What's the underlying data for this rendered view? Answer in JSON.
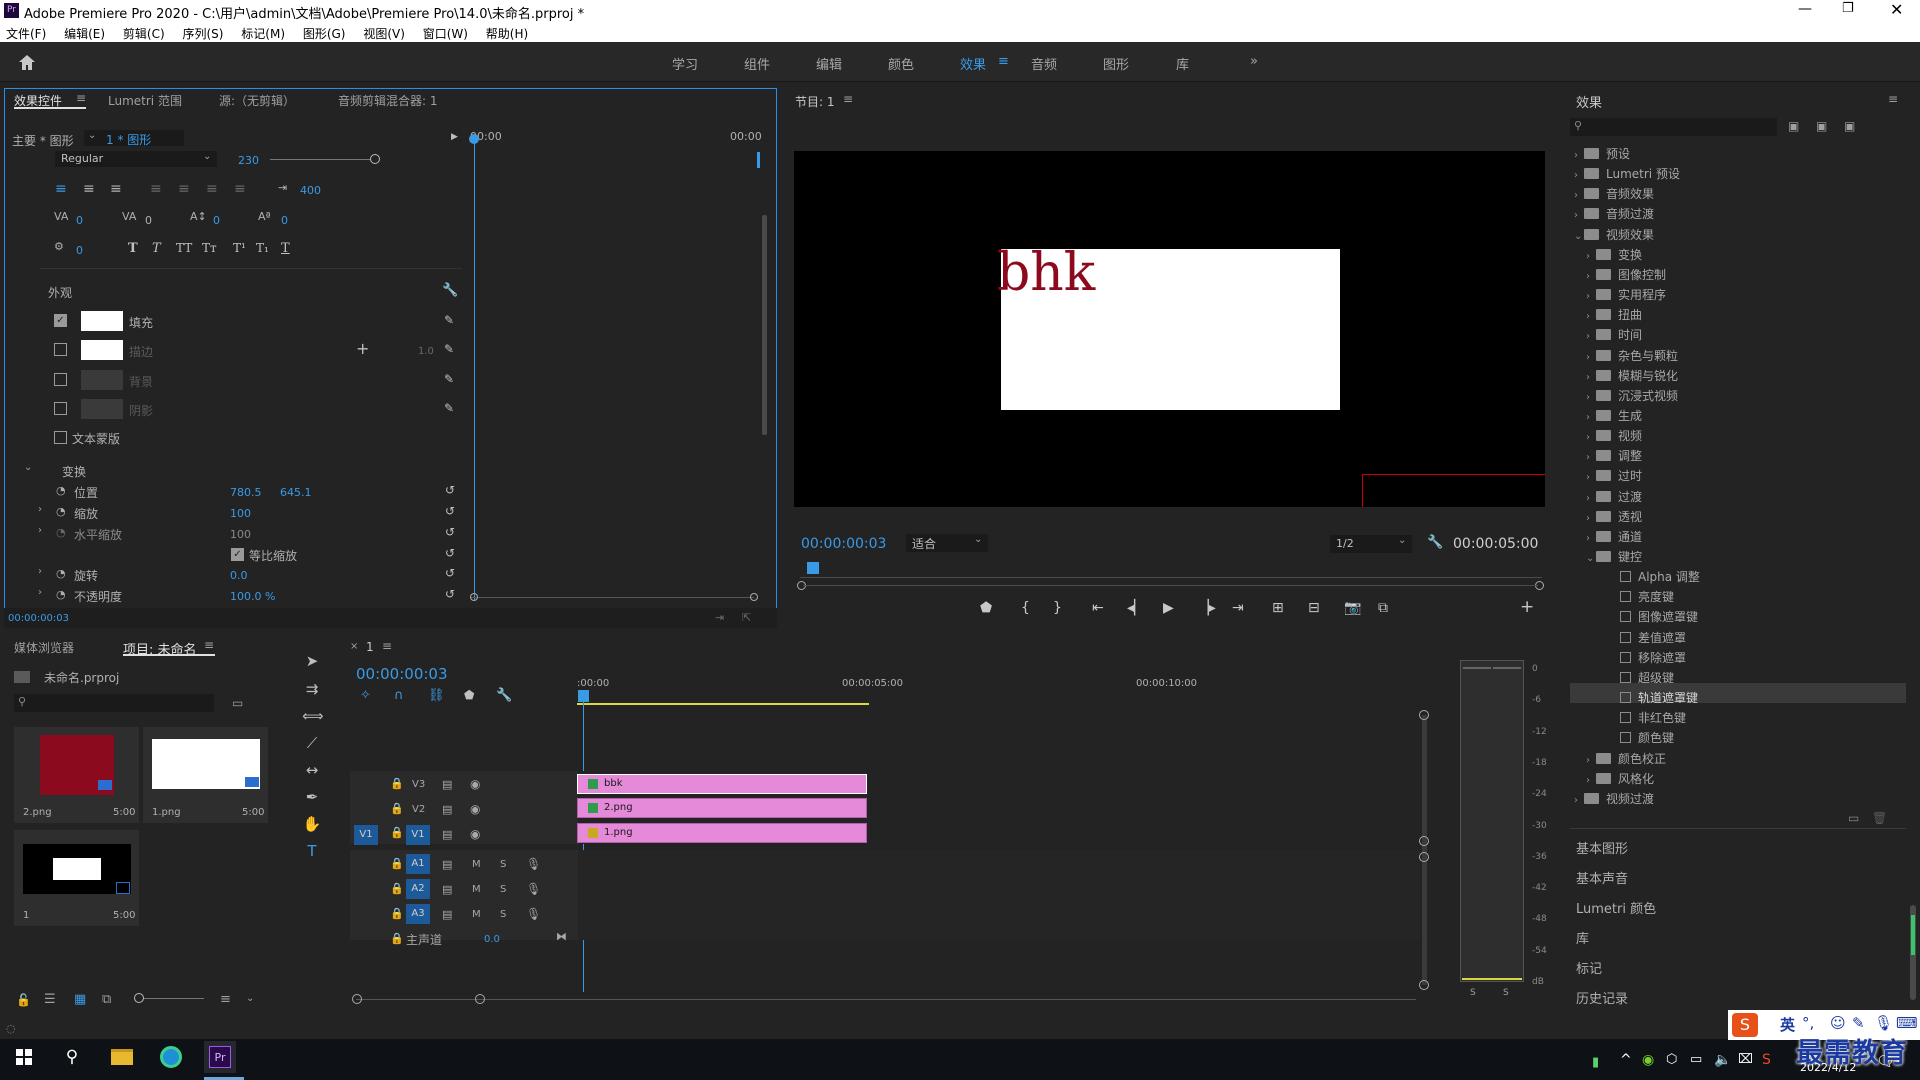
{
  "window": {
    "title": "Adobe Premiere Pro 2020 - C:\\用户\\admin\\文档\\Adobe\\Premiere Pro\\14.0\\未命名.prproj *"
  },
  "menu": [
    "文件(F)",
    "编辑(E)",
    "剪辑(C)",
    "序列(S)",
    "标记(M)",
    "图形(G)",
    "视图(V)",
    "窗口(W)",
    "帮助(H)"
  ],
  "workspaces": {
    "tabs": [
      "学习",
      "组件",
      "编辑",
      "颜色",
      "效果",
      "音频",
      "图形",
      "库"
    ],
    "active": "效果"
  },
  "effect_controls": {
    "tabs": [
      "效果控件",
      "Lumetri 范围",
      "源:（无剪辑）",
      "音频剪辑混合器: 1"
    ],
    "master": "主要 * 图形",
    "clip": "1 * 图形",
    "timecode_start": "00:00",
    "timecode_end": "00:00",
    "font_style": "Regular",
    "font_size": "230",
    "tracking_lead": "400",
    "kerning": "0",
    "tracking": "0",
    "leading": "0",
    "baseline": "0",
    "tsume": "0",
    "appearance_label": "外观",
    "fill_label": "填充",
    "stroke_label": "描边",
    "stroke_width": "1.0",
    "background_label": "背景",
    "shadow_label": "阴影",
    "text_mask_label": "文本蒙版",
    "transform_label": "变换",
    "position_label": "位置",
    "position_x": "780.5",
    "position_y": "645.1",
    "scale_label": "缩放",
    "scale_value": "100",
    "hscale_label": "水平缩放",
    "hscale_value": "100",
    "uniform_label": "等比缩放",
    "rotate_label": "旋转",
    "rotate_value": "0.0",
    "opacity_label": "不透明度",
    "opacity_value": "100.0 %",
    "footer_time": "00:00:00:03"
  },
  "program_monitor": {
    "title": "节目: 1",
    "overlay_text": "bhk",
    "timecode": "00:00:00:03",
    "fit": "适合",
    "resolution": "1/2",
    "duration": "00:00:05:00"
  },
  "effects_panel": {
    "title": "效果",
    "tree": [
      {
        "label": "预设",
        "level": 0,
        "kind": "folder"
      },
      {
        "label": "Lumetri 预设",
        "level": 0,
        "kind": "folder"
      },
      {
        "label": "音频效果",
        "level": 0,
        "kind": "folder"
      },
      {
        "label": "音频过渡",
        "level": 0,
        "kind": "folder"
      },
      {
        "label": "视频效果",
        "level": 0,
        "kind": "folder",
        "open": true
      },
      {
        "label": "变换",
        "level": 1,
        "kind": "folder"
      },
      {
        "label": "图像控制",
        "level": 1,
        "kind": "folder"
      },
      {
        "label": "实用程序",
        "level": 1,
        "kind": "folder"
      },
      {
        "label": "扭曲",
        "level": 1,
        "kind": "folder"
      },
      {
        "label": "时间",
        "level": 1,
        "kind": "folder"
      },
      {
        "label": "杂色与颗粒",
        "level": 1,
        "kind": "folder"
      },
      {
        "label": "模糊与锐化",
        "level": 1,
        "kind": "folder"
      },
      {
        "label": "沉浸式视频",
        "level": 1,
        "kind": "folder"
      },
      {
        "label": "生成",
        "level": 1,
        "kind": "folder"
      },
      {
        "label": "视频",
        "level": 1,
        "kind": "folder"
      },
      {
        "label": "调整",
        "level": 1,
        "kind": "folder"
      },
      {
        "label": "过时",
        "level": 1,
        "kind": "folder"
      },
      {
        "label": "过渡",
        "level": 1,
        "kind": "folder"
      },
      {
        "label": "透视",
        "level": 1,
        "kind": "folder"
      },
      {
        "label": "通道",
        "level": 1,
        "kind": "folder"
      },
      {
        "label": "键控",
        "level": 1,
        "kind": "folder",
        "open": true
      },
      {
        "label": "Alpha 调整",
        "level": 2,
        "kind": "effect"
      },
      {
        "label": "亮度键",
        "level": 2,
        "kind": "effect"
      },
      {
        "label": "图像遮罩键",
        "level": 2,
        "kind": "effect"
      },
      {
        "label": "差值遮罩",
        "level": 2,
        "kind": "effect"
      },
      {
        "label": "移除遮罩",
        "level": 2,
        "kind": "effect"
      },
      {
        "label": "超级键",
        "level": 2,
        "kind": "effect"
      },
      {
        "label": "轨道遮罩键",
        "level": 2,
        "kind": "effect",
        "selected": true
      },
      {
        "label": "非红色键",
        "level": 2,
        "kind": "effect"
      },
      {
        "label": "颜色键",
        "level": 2,
        "kind": "effect"
      },
      {
        "label": "颜色校正",
        "level": 1,
        "kind": "folder"
      },
      {
        "label": "风格化",
        "level": 1,
        "kind": "folder"
      },
      {
        "label": "视频过渡",
        "level": 0,
        "kind": "folder"
      }
    ],
    "side_panels": [
      "基本图形",
      "基本声音",
      "Lumetri 颜色",
      "库",
      "标记",
      "历史记录"
    ]
  },
  "project": {
    "tabs": [
      "媒体浏览器",
      "项目: 未命名"
    ],
    "file": "未命名.prproj",
    "items": [
      {
        "name": "2.png",
        "duration": "5:00",
        "color": "#8b0a1e"
      },
      {
        "name": "1.png",
        "duration": "5:00",
        "color": "#ffffff"
      },
      {
        "name": "1",
        "duration": "5:00",
        "color": "#000000"
      }
    ]
  },
  "timeline": {
    "tab": "1",
    "timecode": "00:00:00:03",
    "ruler": [
      ":00:00",
      "00:00:05:00",
      "00:00:10:00"
    ],
    "video_tracks": [
      {
        "name": "V3",
        "clip": "bbk"
      },
      {
        "name": "V2",
        "clip": "2.png"
      },
      {
        "name": "V1",
        "clip": "1.png"
      }
    ],
    "audio_tracks": [
      "A1",
      "A2",
      "A3"
    ],
    "master": "主声道",
    "master_value": "0.0",
    "source_v": "V1"
  },
  "meter": {
    "ticks": [
      "0",
      "-6",
      "-12",
      "-18",
      "-24",
      "-30",
      "-36",
      "-42",
      "-48",
      "-54",
      "dB"
    ],
    "solo": [
      "S",
      "S"
    ]
  },
  "taskbar": {
    "ime": "英",
    "date": "2022/4/12",
    "watermark": "最需教育"
  }
}
